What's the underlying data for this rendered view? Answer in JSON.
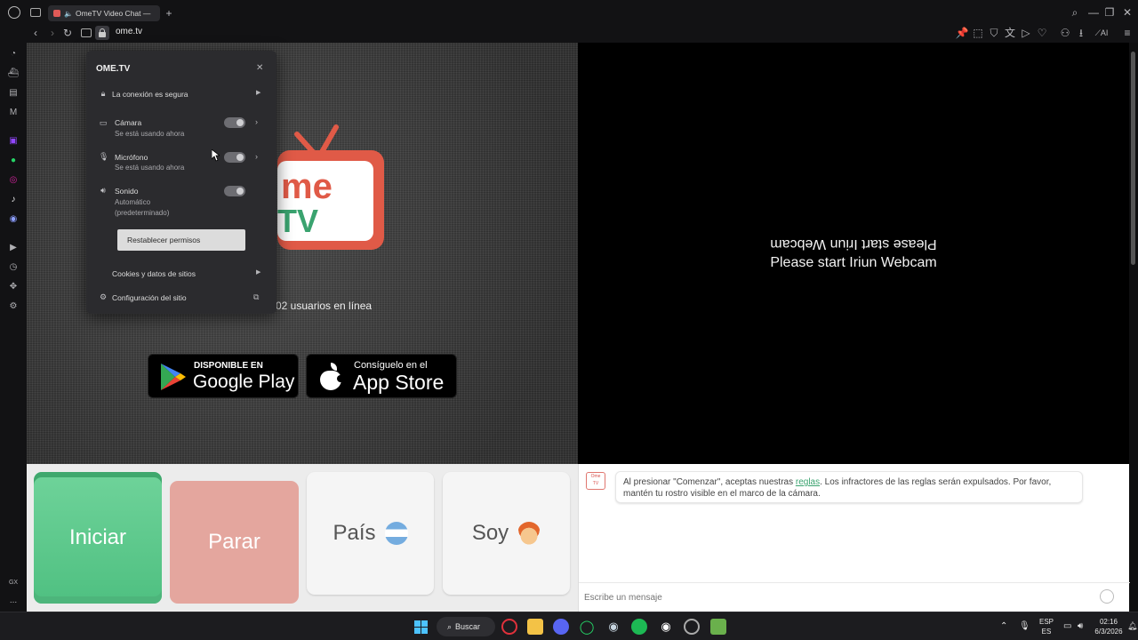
{
  "browser": {
    "tab_title": "OmeTV Video Chat — ",
    "url": "ome.tv",
    "new_tab_label": "+"
  },
  "popup": {
    "site": "OME.TV",
    "secure": "La conexión es segura",
    "camera": {
      "label": "Cámara",
      "status": "Se está usando ahora"
    },
    "mic": {
      "label": "Micrófono",
      "status": "Se está usando ahora"
    },
    "sound": {
      "label": "Sonido",
      "status_1": "Automático",
      "status_2": "(predeterminado)"
    },
    "reset": "Restablecer permisos",
    "cookies": "Cookies y datos de sitios",
    "settings": "Configuración del sitio"
  },
  "stage": {
    "users_online": "02 usuarios en línea",
    "google_small": "DISPONIBLE EN",
    "google_big": "Google Play",
    "apple_small": "Consíguelo en el",
    "apple_big": "App Store",
    "webcam_msg_mirrored": "Please start Iriun Webcam",
    "webcam_msg": "Please start Iriun Webcam",
    "logo_text_1": "me",
    "logo_text_2": "TV"
  },
  "controls": {
    "start": "Iniciar",
    "stop": "Parar",
    "country": "País",
    "gender": "Soy"
  },
  "chat": {
    "avatar_line1": "Ome",
    "avatar_line2": "TV",
    "notice_pre": "Al presionar \"Comenzar\", aceptas nuestras ",
    "notice_link": "reglas",
    "notice_post": ". Los infractores de las reglas serán expulsados. Por favor, mantén tu rostro visible en el marco de la cámara.",
    "input_placeholder": "Escribe un mensaje"
  },
  "taskbar": {
    "search": "Buscar",
    "lang_1": "ESP",
    "lang_2": "ES",
    "time": "02:16",
    "date": "6/3/2026"
  },
  "sidebar": {
    "gx_label": "GX",
    "more_label": "..."
  },
  "colors": {
    "accent_green": "#4fc081",
    "stop_red": "#e4a69e",
    "logo_red": "#e05a47",
    "logo_green": "#3aa36f"
  }
}
